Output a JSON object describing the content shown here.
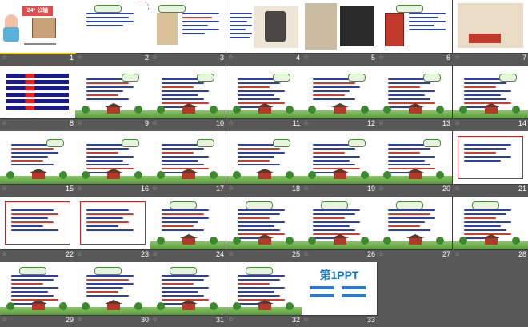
{
  "slides": [
    {
      "number": "1",
      "title": "24* 公输",
      "selected": true
    },
    {
      "number": "2"
    },
    {
      "number": "3"
    },
    {
      "number": "4"
    },
    {
      "number": "5"
    },
    {
      "number": "6"
    },
    {
      "number": "7"
    },
    {
      "number": "8"
    },
    {
      "number": "9"
    },
    {
      "number": "10"
    },
    {
      "number": "11"
    },
    {
      "number": "12"
    },
    {
      "number": "13"
    },
    {
      "number": "14"
    },
    {
      "number": "15"
    },
    {
      "number": "16"
    },
    {
      "number": "17"
    },
    {
      "number": "18"
    },
    {
      "number": "19"
    },
    {
      "number": "20"
    },
    {
      "number": "21"
    },
    {
      "number": "22"
    },
    {
      "number": "23"
    },
    {
      "number": "24"
    },
    {
      "number": "25"
    },
    {
      "number": "26"
    },
    {
      "number": "27"
    },
    {
      "number": "28"
    },
    {
      "number": "29"
    },
    {
      "number": "30"
    },
    {
      "number": "31"
    },
    {
      "number": "32"
    },
    {
      "number": "33",
      "logo": "第1PPT"
    }
  ],
  "slide_star": "☆",
  "icons": {
    "slide_star": "star-icon"
  },
  "colors": {
    "background": "#585858",
    "selected_outline": "#f5c400",
    "slide_number": "#ffffff"
  }
}
